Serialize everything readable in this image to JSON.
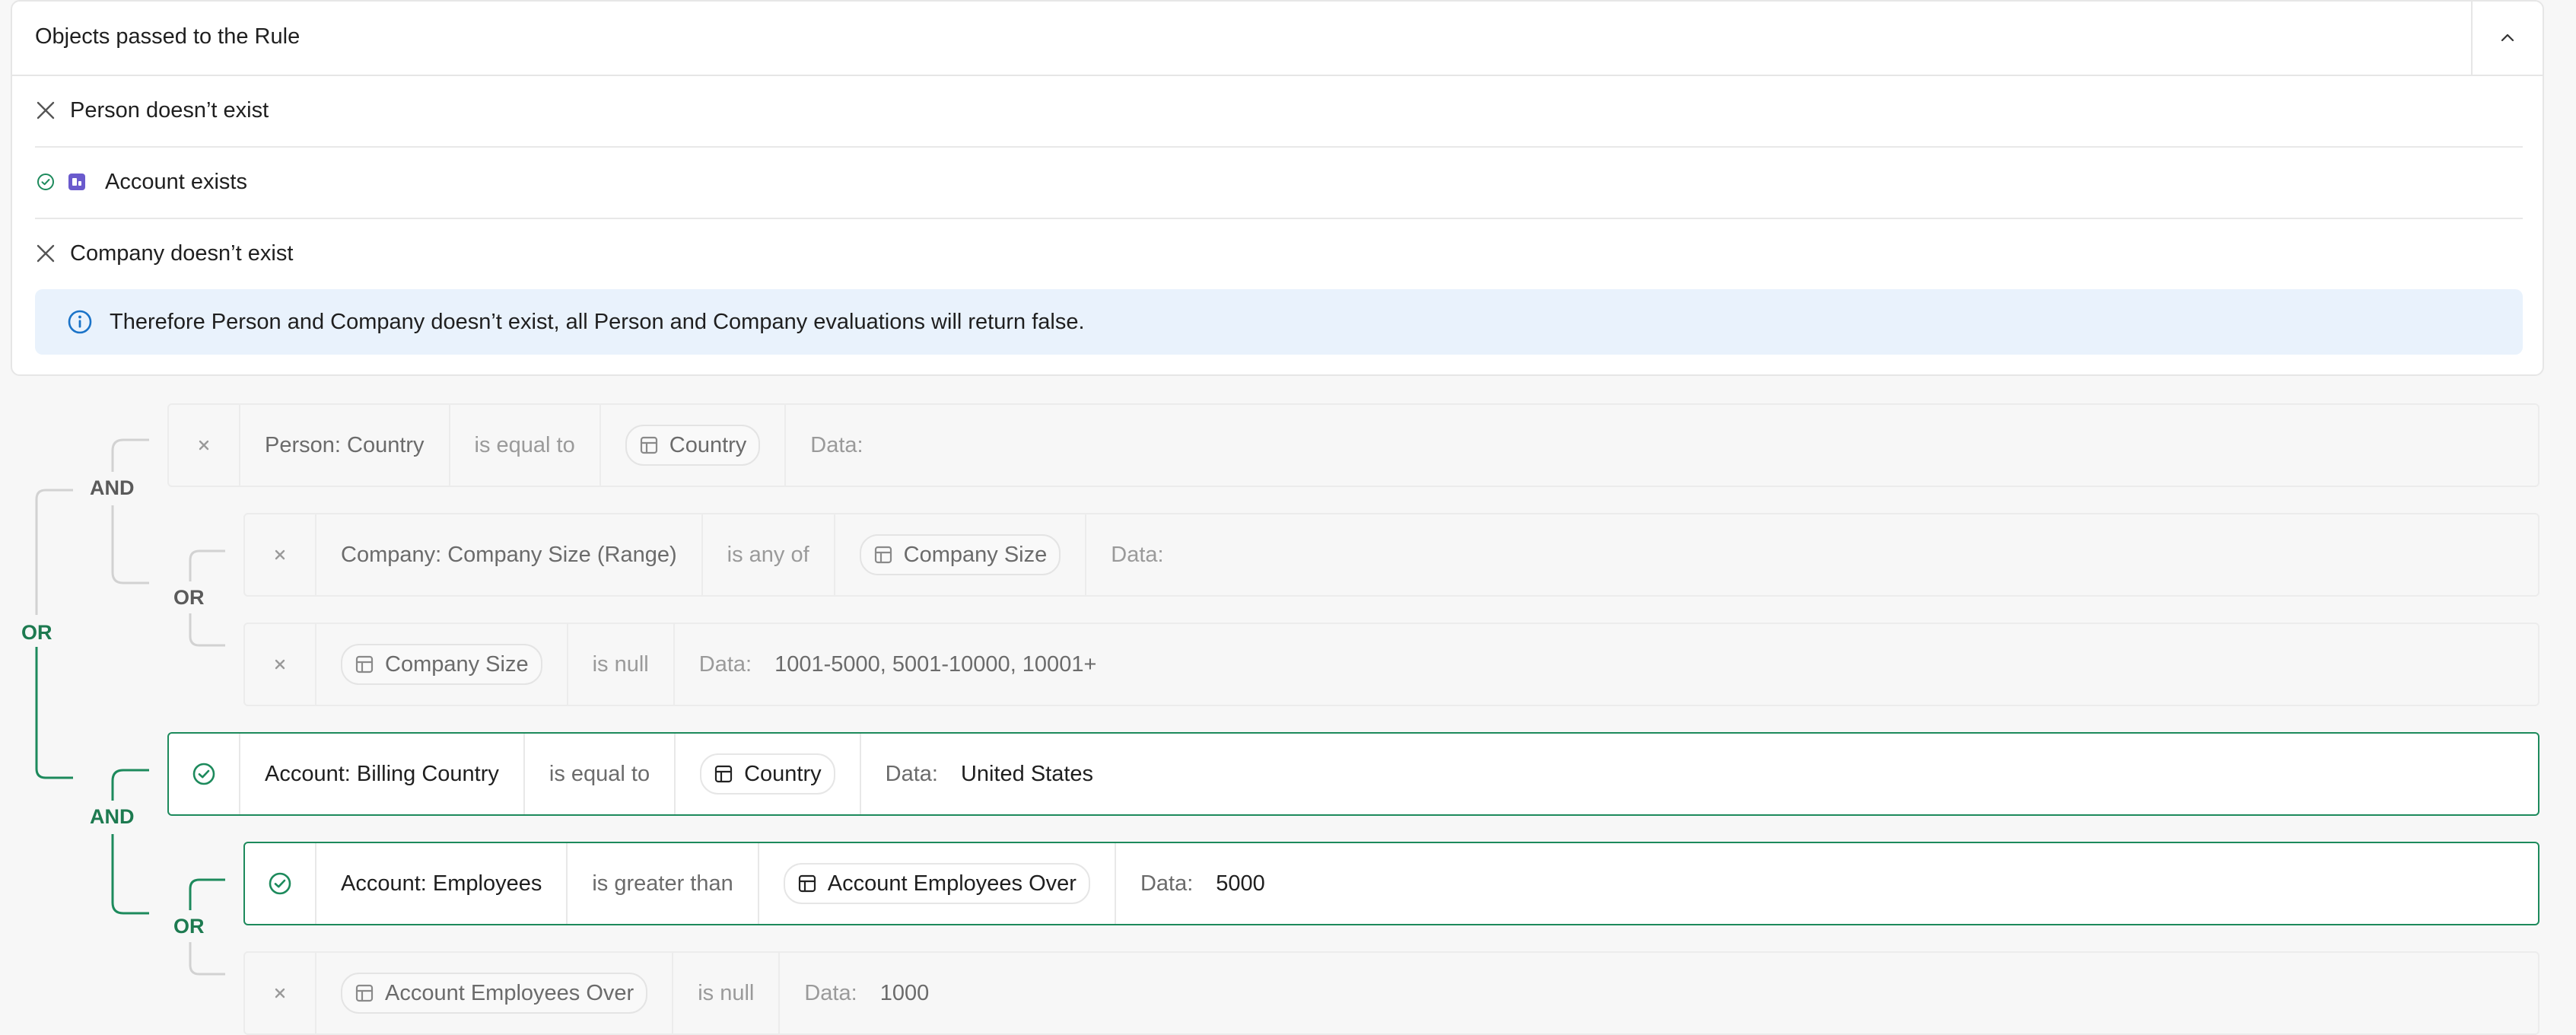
{
  "panel": {
    "title": "Objects passed to the Rule",
    "collapse_icon": "chevron-up-icon",
    "objects": [
      {
        "label": "Person doesn’t exist",
        "status": "missing",
        "icon": "close-icon"
      },
      {
        "label": "Account exists",
        "status": "exists",
        "icon": "check-circle-icon",
        "type_icon": "account-icon"
      },
      {
        "label": "Company doesn’t exist",
        "status": "missing",
        "icon": "close-icon"
      }
    ],
    "info": "Therefore Person and Company doesn’t exist, all Person and Company evaluations will return false."
  },
  "logic": {
    "top_or": "OR",
    "group1_and": "AND",
    "group1_or": "OR",
    "group2_and": "AND",
    "group2_or": "OR"
  },
  "conditions": [
    {
      "status": "fail",
      "field": "Person: Country",
      "operator": "is equal to",
      "value": "Country",
      "data_label": "Data:",
      "data": ""
    },
    {
      "status": "fail",
      "field": "Company: Company Size (Range)",
      "operator": "is any of",
      "value": "Company Size",
      "data_label": "Data:",
      "data": ""
    },
    {
      "status": "fail",
      "field": "",
      "operator": "is null",
      "value": "Company Size",
      "data_label": "Data:",
      "data": "1001-5000, 5001-10000, 10001+"
    },
    {
      "status": "pass",
      "field": "Account: Billing Country",
      "operator": "is equal to",
      "value": "Country",
      "data_label": "Data:",
      "data": "United States"
    },
    {
      "status": "pass",
      "field": "Account: Employees",
      "operator": "is greater than",
      "value": "Account Employees Over",
      "data_label": "Data:",
      "data": "5000"
    },
    {
      "status": "fail",
      "field": "",
      "operator": "is null",
      "value": "Account Employees Over",
      "data_label": "Data:",
      "data": "1000"
    }
  ],
  "colors": {
    "pass": "#1d8a5c",
    "info_bg": "#e9f2fc",
    "info_icon": "#1a73c8",
    "account_badge": "#6a5acd"
  }
}
